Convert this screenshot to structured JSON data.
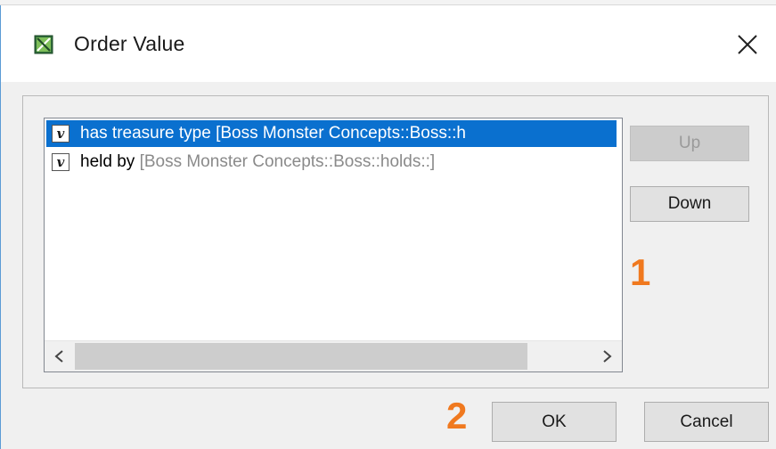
{
  "dialog": {
    "title": "Order Value",
    "close_glyph": "✕"
  },
  "list": {
    "items": [
      {
        "icon": "v",
        "icon_name": "value-property-icon",
        "name": "has treasure type",
        "qualifier": "[Boss Monster Concepts::Boss::h",
        "selected": true
      },
      {
        "icon": "v",
        "icon_name": "value-property-icon",
        "name": "held by",
        "qualifier": "[Boss Monster Concepts::Boss::holds::]",
        "selected": false
      }
    ],
    "scroll_left_glyph": "‹",
    "scroll_right_glyph": "›"
  },
  "buttons": {
    "up": "Up",
    "down": "Down",
    "ok": "OK",
    "cancel": "Cancel"
  },
  "annotations": {
    "one": "1",
    "two": "2"
  },
  "colors": {
    "selection": "#0a70cf",
    "annotation": "#f0791f",
    "window_border": "#5b9bd5"
  }
}
